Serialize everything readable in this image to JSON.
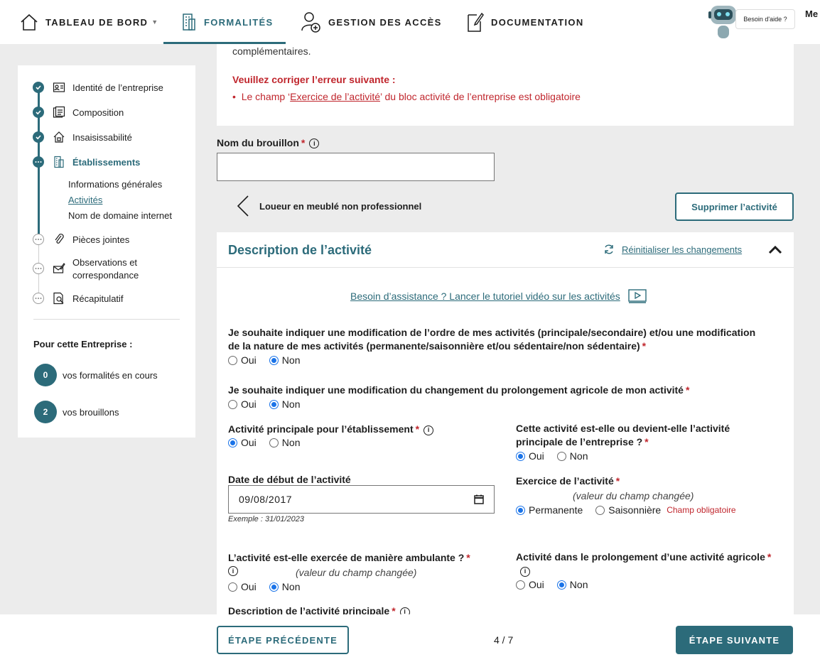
{
  "nav": {
    "dashboard": "TABLEAU DE BORD",
    "formalities": "FORMALITÉS",
    "access": "GESTION DES ACCÈS",
    "documentation": "DOCUMENTATION",
    "help": "Besoin d'aide ?",
    "truncated": "Me"
  },
  "sidebar": {
    "steps": [
      {
        "label": "Identité de l’entreprise",
        "state": "done"
      },
      {
        "label": "Composition",
        "state": "done"
      },
      {
        "label": "Insaisissabilité",
        "state": "done"
      },
      {
        "label": "Établissements",
        "state": "current"
      },
      {
        "label": "Pièces jointes",
        "state": "todo"
      },
      {
        "label": "Observations et correspondance",
        "state": "todo"
      },
      {
        "label": "Récapitulatif",
        "state": "todo"
      }
    ],
    "substeps": [
      "Informations générales",
      "Activités",
      "Nom de domaine internet"
    ],
    "company_title": "Pour cette Entreprise :",
    "formalities_count": "0",
    "formalities_label": "vos formalités en cours",
    "drafts_count": "2",
    "drafts_label": "vos brouillons"
  },
  "error": {
    "cut_text": "complémentaires.",
    "title": "Veuillez corriger l’erreur suivante :",
    "item_prefix": "Le champ ‘",
    "item_link": "Exercice de l’activité",
    "item_suffix": "’ du bloc activité de l’entreprise est obligatoire"
  },
  "draft": {
    "label": "Nom du brouillon",
    "value": ""
  },
  "activity": {
    "back_label": "Loueur en meublé non professionnel",
    "delete_label": "Supprimer l’activité"
  },
  "description": {
    "title": "Description de l’activité",
    "reset": "Réinitialiser les changements",
    "tutorial": "Besoin d’assistance ? Lancer le tutoriel vidéo sur les activités",
    "q1": "Je souhaite indiquer une modification de l’ordre de mes activités (principale/secondaire) et/ou une modification de la nature de mes activités (permanente/saisonnière et/ou sédentaire/non sédentaire)",
    "q2": "Je souhaite indiquer une modification du changement du prolongement agricole de mon activité",
    "q3": "Activité principale pour l’établissement",
    "q4": "Cette activité est-elle ou devient-elle l’activité principale de l’entreprise ?",
    "q5": "Date de début de l’activité",
    "q5_value": "09/08/2017",
    "q5_example": "Exemple : 31/01/2023",
    "q6": "Exercice de l’activité",
    "q6_changed": "(valeur du champ changée)",
    "q6_opt1": "Permanente",
    "q6_opt2": "Saisonnière",
    "q6_error": "Champ obligatoire",
    "q7": "L’activité est-elle exercée de manière ambulante ?",
    "q7_changed": "(valeur du champ changée)",
    "q8": "Activité dans le prolongement d’une activité agricole",
    "q9": "Description de l’activité principale",
    "yes": "Oui",
    "no": "Non"
  },
  "footer": {
    "prev": "ÉTAPE PRÉCÉDENTE",
    "pager": "4 / 7",
    "next": "ÉTAPE SUIVANTE"
  },
  "colors": {
    "accent": "#2c6b7a",
    "error": "#c0262d",
    "radio": "#1a73e8"
  }
}
